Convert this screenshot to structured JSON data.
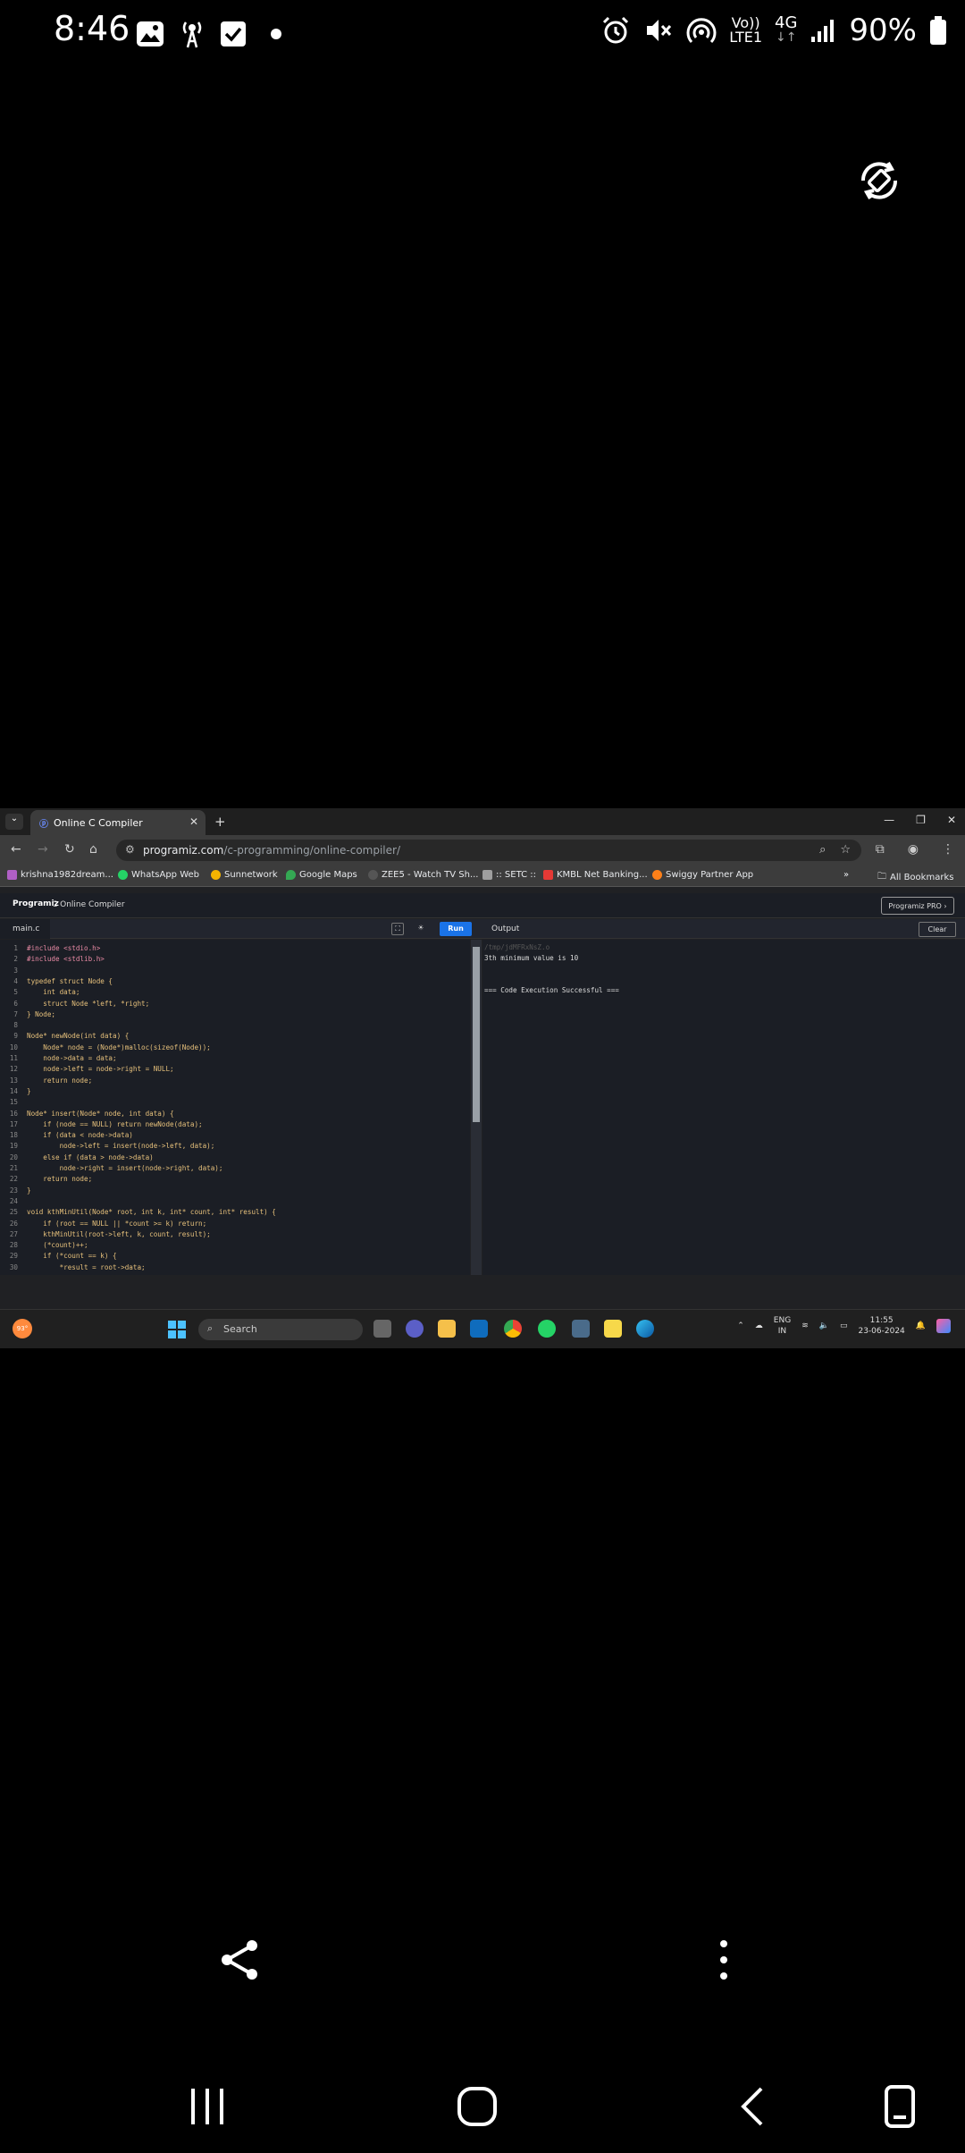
{
  "status_bar": {
    "time": "8:46",
    "battery": "90%",
    "network_small_top": "Vo))",
    "network_small_bottom": "LTE1",
    "network_gen": "4G"
  },
  "browser": {
    "tab_title": "Online C Compiler",
    "url_host": "programiz.com",
    "url_path": "/c-programming/online-compiler/",
    "bookmarks": [
      {
        "label": "krishna1982dream...",
        "color": "#b05fc5"
      },
      {
        "label": "WhatsApp Web",
        "color": "#25d366"
      },
      {
        "label": "Sunnetwork",
        "color": "#f4b400"
      },
      {
        "label": "Google Maps",
        "color": "#34a853"
      },
      {
        "label": "ZEE5 - Watch TV Sh...",
        "color": "#222222"
      },
      {
        "label": ":: SETC ::",
        "color": "#9e9e9e"
      },
      {
        "label": "KMBL Net Banking...",
        "color": "#e53935"
      },
      {
        "label": "Swiggy Partner App",
        "color": "#fc8019"
      }
    ],
    "all_bookmarks": "All Bookmarks"
  },
  "programiz": {
    "logo": "Programiz",
    "title": "C Online Compiler",
    "pro_button": "Programiz PRO ›",
    "file_tab": "main.c",
    "run_button": "Run",
    "output_label": "Output",
    "clear_button": "Clear"
  },
  "code_lines": [
    {
      "n": "1",
      "text": "#include <stdio.h>"
    },
    {
      "n": "2",
      "text": "#include <stdlib.h>"
    },
    {
      "n": "3",
      "text": ""
    },
    {
      "n": "4",
      "text": "typedef struct Node {"
    },
    {
      "n": "5",
      "text": "    int data;"
    },
    {
      "n": "6",
      "text": "    struct Node *left, *right;"
    },
    {
      "n": "7",
      "text": "} Node;"
    },
    {
      "n": "8",
      "text": ""
    },
    {
      "n": "9",
      "text": "Node* newNode(int data) {"
    },
    {
      "n": "10",
      "text": "    Node* node = (Node*)malloc(sizeof(Node));"
    },
    {
      "n": "11",
      "text": "    node->data = data;"
    },
    {
      "n": "12",
      "text": "    node->left = node->right = NULL;"
    },
    {
      "n": "13",
      "text": "    return node;"
    },
    {
      "n": "14",
      "text": "}"
    },
    {
      "n": "15",
      "text": ""
    },
    {
      "n": "16",
      "text": "Node* insert(Node* node, int data) {"
    },
    {
      "n": "17",
      "text": "    if (node == NULL) return newNode(data);"
    },
    {
      "n": "18",
      "text": "    if (data < node->data)"
    },
    {
      "n": "19",
      "text": "        node->left = insert(node->left, data);"
    },
    {
      "n": "20",
      "text": "    else if (data > node->data)"
    },
    {
      "n": "21",
      "text": "        node->right = insert(node->right, data);"
    },
    {
      "n": "22",
      "text": "    return node;"
    },
    {
      "n": "23",
      "text": "}"
    },
    {
      "n": "24",
      "text": ""
    },
    {
      "n": "25",
      "text": "void kthMinUtil(Node* root, int k, int* count, int* result) {"
    },
    {
      "n": "26",
      "text": "    if (root == NULL || *count >= k) return;"
    },
    {
      "n": "27",
      "text": "    kthMinUtil(root->left, k, count, result);"
    },
    {
      "n": "28",
      "text": "    (*count)++;"
    },
    {
      "n": "29",
      "text": "    if (*count == k) {"
    },
    {
      "n": "30",
      "text": "        *result = root->data;"
    }
  ],
  "output": {
    "cmd": "/tmp/jdMFRxNsZ.o",
    "line1": "3th minimum value is 10",
    "line2": "=== Code Execution Successful ==="
  },
  "taskbar": {
    "weather": "93°",
    "search": "Search",
    "lang_top": "ENG",
    "lang_bottom": "IN",
    "time": "11:55",
    "date": "23-06-2024"
  }
}
